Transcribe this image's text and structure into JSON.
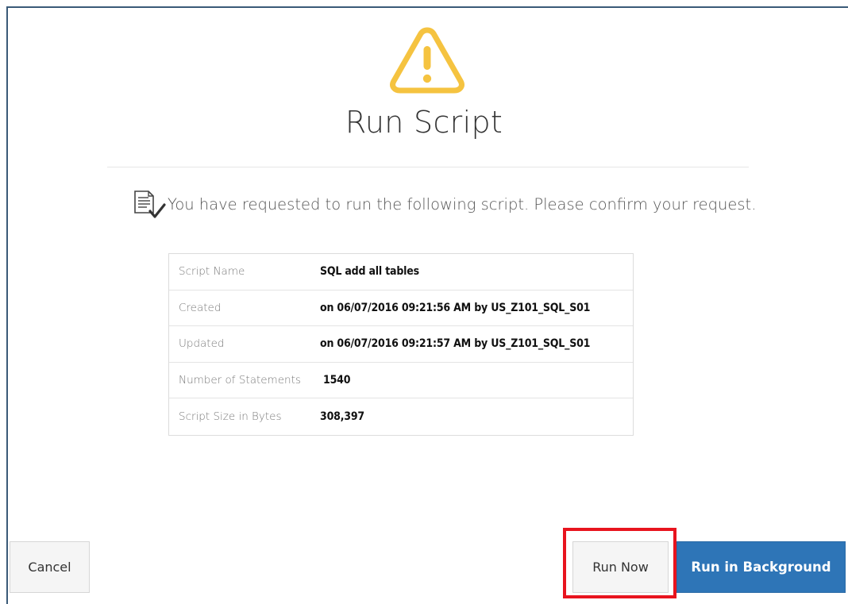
{
  "dialog": {
    "title": "Run Script",
    "message": "You have requested to run the following script. Please confirm your request.",
    "icons": {
      "header": "warning-icon",
      "message": "document-check-icon"
    },
    "accent_color": "#f5c340"
  },
  "details": [
    {
      "label": "Script Name",
      "value": "SQL add all tables"
    },
    {
      "label": "Created",
      "value": "on 06/07/2016 09:21:56 AM by US_Z101_SQL_S01"
    },
    {
      "label": "Updated",
      "value": "on 06/07/2016 09:21:57 AM by US_Z101_SQL_S01"
    },
    {
      "label": "Number of Statements",
      "value": "1540"
    },
    {
      "label": "Script Size in Bytes",
      "value": "308,397"
    }
  ],
  "buttons": {
    "cancel": "Cancel",
    "run_now": "Run Now",
    "run_in_background": "Run in Background"
  },
  "colors": {
    "primary_button": "#2e75b7",
    "highlight_box": "#e8141e"
  }
}
